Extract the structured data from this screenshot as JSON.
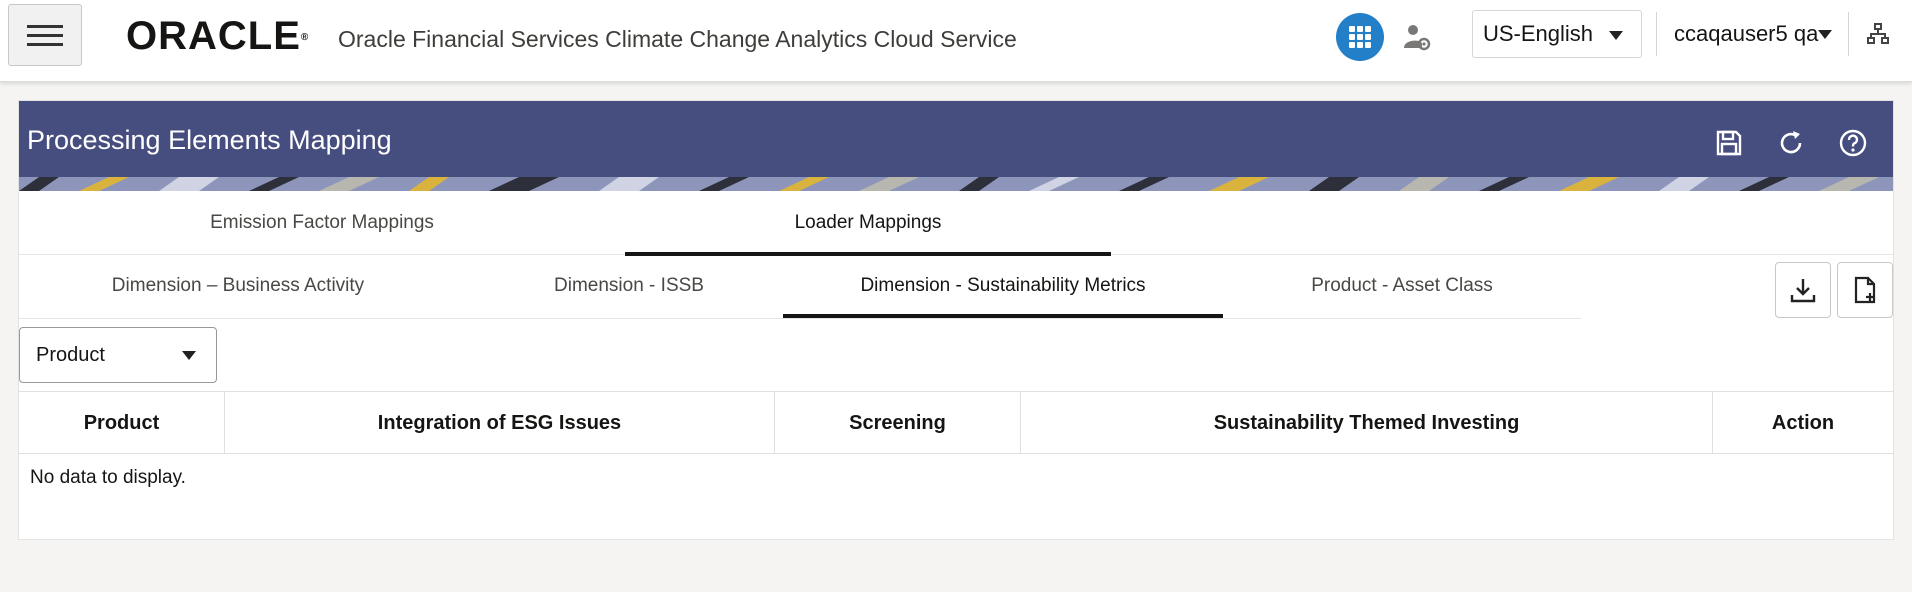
{
  "header": {
    "brand": "ORACLE",
    "app_title": "Oracle Financial Services Climate Change Analytics Cloud Service",
    "language": "US-English",
    "user": "ccaqauser5 qa"
  },
  "panel": {
    "title": "Processing Elements Mapping"
  },
  "primary_tabs": [
    {
      "label": "Emission Factor Mappings",
      "active": false
    },
    {
      "label": "Loader Mappings",
      "active": true
    }
  ],
  "secondary_tabs": [
    {
      "label": "Dimension – Business Activity",
      "active": false
    },
    {
      "label": "Dimension - ISSB",
      "active": false
    },
    {
      "label": "Dimension - Sustainability Metrics",
      "active": true
    },
    {
      "label": "Product - Asset Class",
      "active": false
    }
  ],
  "filter": {
    "selected": "Product"
  },
  "table": {
    "columns": [
      "Product",
      "Integration of ESG Issues",
      "Screening",
      "Sustainability Themed Investing",
      "Action"
    ],
    "empty_message": "No data to display."
  },
  "colors": {
    "panel_header": "#464d7f",
    "apps_button": "#227fc8"
  },
  "icons": {
    "menu": "hamburger-icon",
    "apps": "grid-icon",
    "admin": "user-gear-icon",
    "sitemap": "sitemap-icon",
    "save": "save-icon",
    "refresh": "refresh-icon",
    "help": "help-icon",
    "download": "download-icon",
    "new_file": "file-plus-icon"
  }
}
